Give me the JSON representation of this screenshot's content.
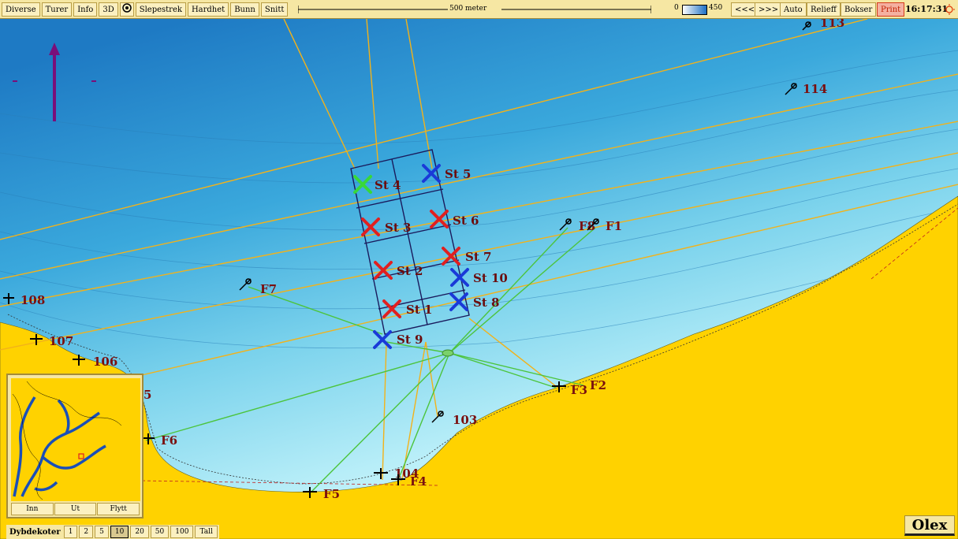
{
  "toolbar": {
    "menu_diverse": "Diverse",
    "menu_turer": "Turer",
    "menu_info": "Info",
    "menu_3d": "3D",
    "menu_slepestrek": "Slepestrek",
    "menu_hardhet": "Hardhet",
    "menu_bunn": "Bunn",
    "menu_snitt": "Snitt",
    "scale_label": "500 meter",
    "depth_min": "0",
    "depth_max": "450",
    "btn_prev": "<<<",
    "btn_next": ">>>",
    "btn_auto": "Auto",
    "btn_relieff": "Relieff",
    "btn_bokser": "Bokser",
    "btn_print": "Print",
    "clock": "16:17:31"
  },
  "stations": [
    {
      "label": "St 4",
      "color": "green"
    },
    {
      "label": "St 5",
      "color": "blue"
    },
    {
      "label": "St 3",
      "color": "red"
    },
    {
      "label": "St 6",
      "color": "red"
    },
    {
      "label": "St 7",
      "color": "red"
    },
    {
      "label": "St 2",
      "color": "red"
    },
    {
      "label": "St 10",
      "color": "blue"
    },
    {
      "label": "St 8",
      "color": "blue"
    },
    {
      "label": "St 1",
      "color": "red"
    },
    {
      "label": "St 9",
      "color": "blue"
    }
  ],
  "anchors": [
    {
      "label": "113"
    },
    {
      "label": "114"
    },
    {
      "label": "F8"
    },
    {
      "label": "F1"
    },
    {
      "label": "F7"
    },
    {
      "label": "108"
    },
    {
      "label": "107"
    },
    {
      "label": "106"
    },
    {
      "label": "5"
    },
    {
      "label": "F3"
    },
    {
      "label": "F2"
    },
    {
      "label": "103"
    },
    {
      "label": "F6"
    },
    {
      "label": "104"
    },
    {
      "label": "F4"
    },
    {
      "label": "F5"
    }
  ],
  "minimap": {
    "btn_inn": "Inn",
    "btn_ut": "Ut",
    "btn_flytt": "Flytt"
  },
  "depth_contours": {
    "label": "Dybdekoter",
    "options": [
      "1",
      "2",
      "5",
      "10",
      "20",
      "50",
      "100",
      "Tall"
    ],
    "selected": "10"
  },
  "logo": "Olex",
  "colors": {
    "sea_deep": "#2a86c8",
    "sea_shallow": "#bff0f8",
    "land": "#ffd200",
    "track_orange": "#f2b21a",
    "track_green": "#4cc43c",
    "grid_navy": "#1a1a5c",
    "marker_red": "#e02020",
    "marker_blue": "#1a3ad8",
    "marker_green": "#38d838",
    "label_dark_red": "#7a0f0f"
  }
}
